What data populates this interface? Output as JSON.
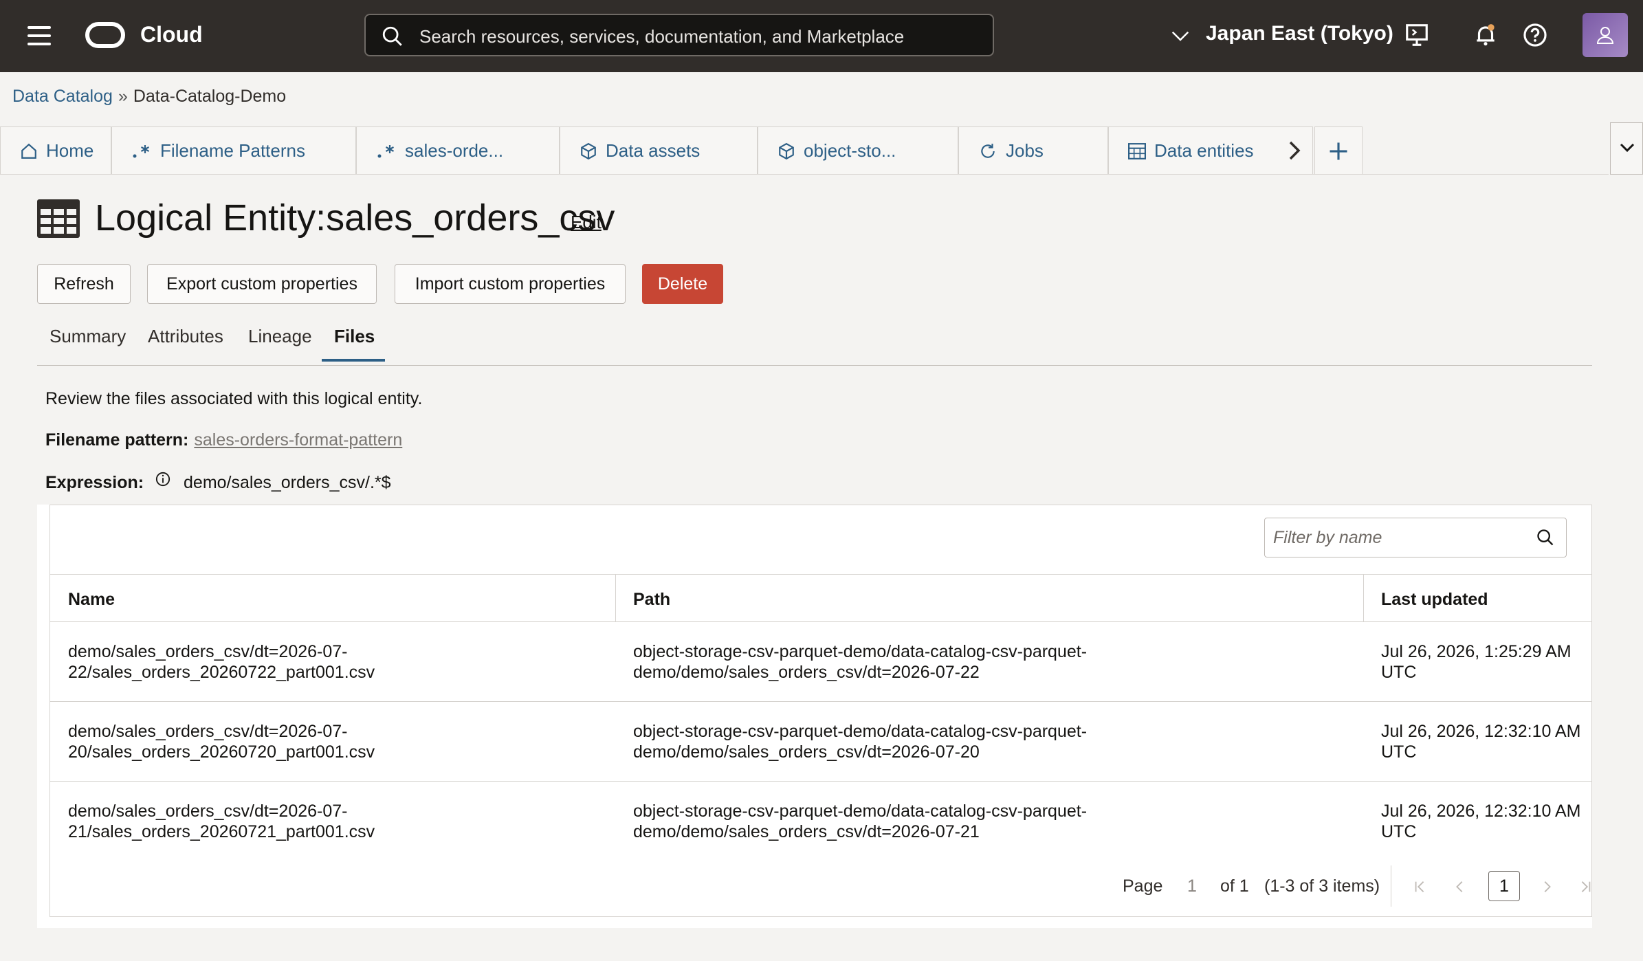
{
  "topbar": {
    "app_name": "Cloud",
    "search_placeholder": "Search resources, services, documentation, and Marketplace",
    "region": "Japan East (Tokyo)"
  },
  "breadcrumb": {
    "parent": "Data Catalog",
    "separator": "»",
    "current": "Data-Catalog-Demo"
  },
  "tabs": [
    {
      "label": "Home",
      "icon": "home-icon"
    },
    {
      "label": "Filename Patterns",
      "icon": "regex-icon"
    },
    {
      "label": "sales-orde...",
      "icon": "regex-icon"
    },
    {
      "label": "Data assets",
      "icon": "cube-icon"
    },
    {
      "label": "object-sto...",
      "icon": "cube-icon"
    },
    {
      "label": "Jobs",
      "icon": "refresh-icon"
    },
    {
      "label": "Data entities",
      "icon": "table-icon"
    }
  ],
  "page": {
    "title": "Logical Entity:sales_orders_csv",
    "edit_label": "Edit"
  },
  "actions": {
    "refresh": "Refresh",
    "export": "Export custom properties",
    "import": "Import custom properties",
    "delete": "Delete"
  },
  "subtabs": [
    "Summary",
    "Attributes",
    "Lineage",
    "Files"
  ],
  "files": {
    "description": "Review the files associated with this logical entity.",
    "filename_pattern_label": "Filename pattern:",
    "filename_pattern_value": "sales-orders-format-pattern",
    "expression_label": "Expression:",
    "expression_value": "demo/sales_orders_csv/.*$",
    "filter_placeholder": "Filter by name",
    "columns": [
      "Name",
      "Path",
      "Last updated"
    ],
    "rows": [
      {
        "name": "demo/sales_orders_csv/dt=2026-07-\n22/sales_orders_20260722_part001.csv",
        "path": "object-storage-csv-parquet-demo/data-catalog-csv-parquet-\ndemo/demo/sales_orders_csv/dt=2026-07-22",
        "updated": "Jul 26, 2026, 1:25:29 AM\nUTC"
      },
      {
        "name": "demo/sales_orders_csv/dt=2026-07-\n20/sales_orders_20260720_part001.csv",
        "path": "object-storage-csv-parquet-demo/data-catalog-csv-parquet-\ndemo/demo/sales_orders_csv/dt=2026-07-20",
        "updated": "Jul 26, 2026, 12:32:10 AM\nUTC"
      },
      {
        "name": "demo/sales_orders_csv/dt=2026-07-\n21/sales_orders_20260721_part001.csv",
        "path": "object-storage-csv-parquet-demo/data-catalog-csv-parquet-\ndemo/demo/sales_orders_csv/dt=2026-07-21",
        "updated": "Jul 26, 2026, 12:32:10 AM\nUTC"
      }
    ],
    "pagination": {
      "page_label": "Page",
      "page_value": "1",
      "of_label": "of 1",
      "items_label": "(1-3 of 3 items)",
      "current": "1"
    }
  },
  "colors": {
    "topbar": "#312d2a",
    "link": "#2d5f86",
    "danger": "#c74634"
  }
}
